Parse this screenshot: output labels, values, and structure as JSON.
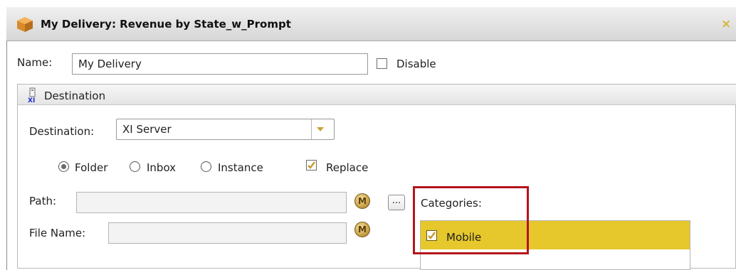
{
  "dialog": {
    "title": "My Delivery: Revenue by State_w_Prompt",
    "close_glyph": "×"
  },
  "name_row": {
    "label": "Name:",
    "value": "My Delivery",
    "disable_label": "Disable",
    "disable_checked": false
  },
  "destination_group": {
    "header": "Destination",
    "header_icon": "xi-server-icon",
    "destination_label": "Destination:",
    "destination_value": "XI Server",
    "radios": [
      {
        "label": "Folder",
        "selected": true
      },
      {
        "label": "Inbox",
        "selected": false
      },
      {
        "label": "Instance",
        "selected": false
      }
    ],
    "replace_label": "Replace",
    "replace_checked": true,
    "path_label": "Path:",
    "path_value": "",
    "browse_label": "...",
    "filename_label": "File Name:",
    "filename_value": "",
    "m_button_glyph": "M",
    "categories_label": "Categories:",
    "categories": [
      {
        "label": "Mobile",
        "checked": true,
        "selected": true
      }
    ]
  },
  "colors": {
    "highlight": "#e6c72c",
    "callout_border": "#b3151c",
    "accent_check": "#c79a2c"
  }
}
